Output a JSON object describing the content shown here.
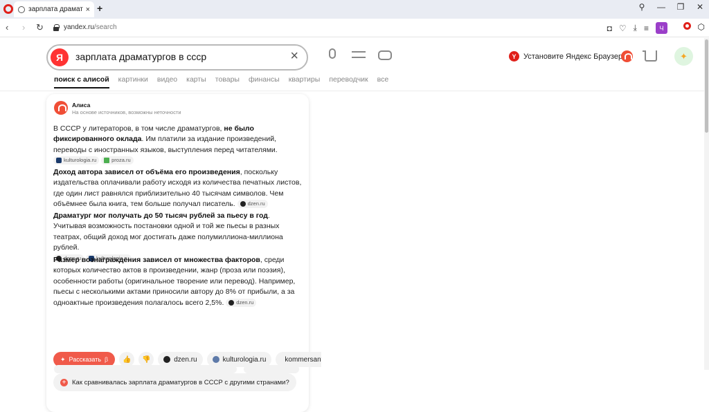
{
  "browser": {
    "tab_title": "зарплата драматургов в",
    "tab_close": "×",
    "new_tab": "+",
    "url_host": "yandex.ru",
    "url_path": "/search",
    "profile_badge": "Ч",
    "nav_back": "‹",
    "nav_forward": "›",
    "nav_reload": "↻",
    "win_search": "⚲",
    "win_minimize": "—",
    "win_restore": "❐",
    "win_close": "✕"
  },
  "search": {
    "logo_letter": "Я",
    "query": "зарплата драматургов в ссср",
    "clear": "×"
  },
  "header": {
    "install_browser": "Установите Яндекс Браузер",
    "ybrowser_letter": "Y"
  },
  "tabs": [
    "поиск с алисой",
    "картинки",
    "видео",
    "карты",
    "товары",
    "финансы",
    "квартиры",
    "переводчик",
    "все"
  ],
  "answer": {
    "author": "Алиса",
    "subtitle": "На основе источников, возможны неточности",
    "p1_pre": "В СССР у литераторов, в том числе драматургов, ",
    "p1_bold": "не было фиксированного оклада",
    "p1_post": ". Им платили за издание произведений, переводы с иностранных языков, выступления перед читателями.",
    "p1_sources": [
      "kulturologia.ru",
      "proza.ru"
    ],
    "p2_bold": "Доход автора зависел от объёма его произведения",
    "p2_post": ", поскольку издательства оплачивали работу исходя из количества печатных листов, где один лист равнялся приблизительно 40 тысячам символов. Чем объёмнее была книга, тем больше получал писатель.",
    "p2_sources": [
      "dzen.ru"
    ],
    "p3_bold": "Драматург мог получать до 50 тысяч рублей за пьесу в год",
    "p3_post": ". Учитывая возможность постановки одной и той же пьесы в разных театрах, общий доход мог достигать даже полумиллиона-миллиона рублей.",
    "p3_sources": [
      "dzen.ru",
      "kulturologia.ru"
    ],
    "p4_bold": "Размер вознаграждения зависел от множества факторов",
    "p4_post": ", среди которых количество актов в произведении, жанр (проза или поэзия), особенности работы (оригинальное творение или перевод). Например, пьесы с несколькими актами приносили автору до 8% от прибыли, а за одноактные произведения полагалось всего 2,5%.",
    "p4_sources": [
      "dzen.ru"
    ],
    "tell_button": "Рассказать",
    "tell_suffix": "β",
    "like": "👍",
    "dislike": "👎",
    "chips": [
      "dzen.ru",
      "kulturologia.ru",
      "kommersant"
    ],
    "followup": "Как сравнивалась зарплата драматургов в СССР с другими странами?",
    "followup_plus": "+"
  },
  "colors": {
    "accent": "#f05a4a",
    "yandex_red": "#ff3333",
    "profile_purple": "#9b3fc9"
  }
}
